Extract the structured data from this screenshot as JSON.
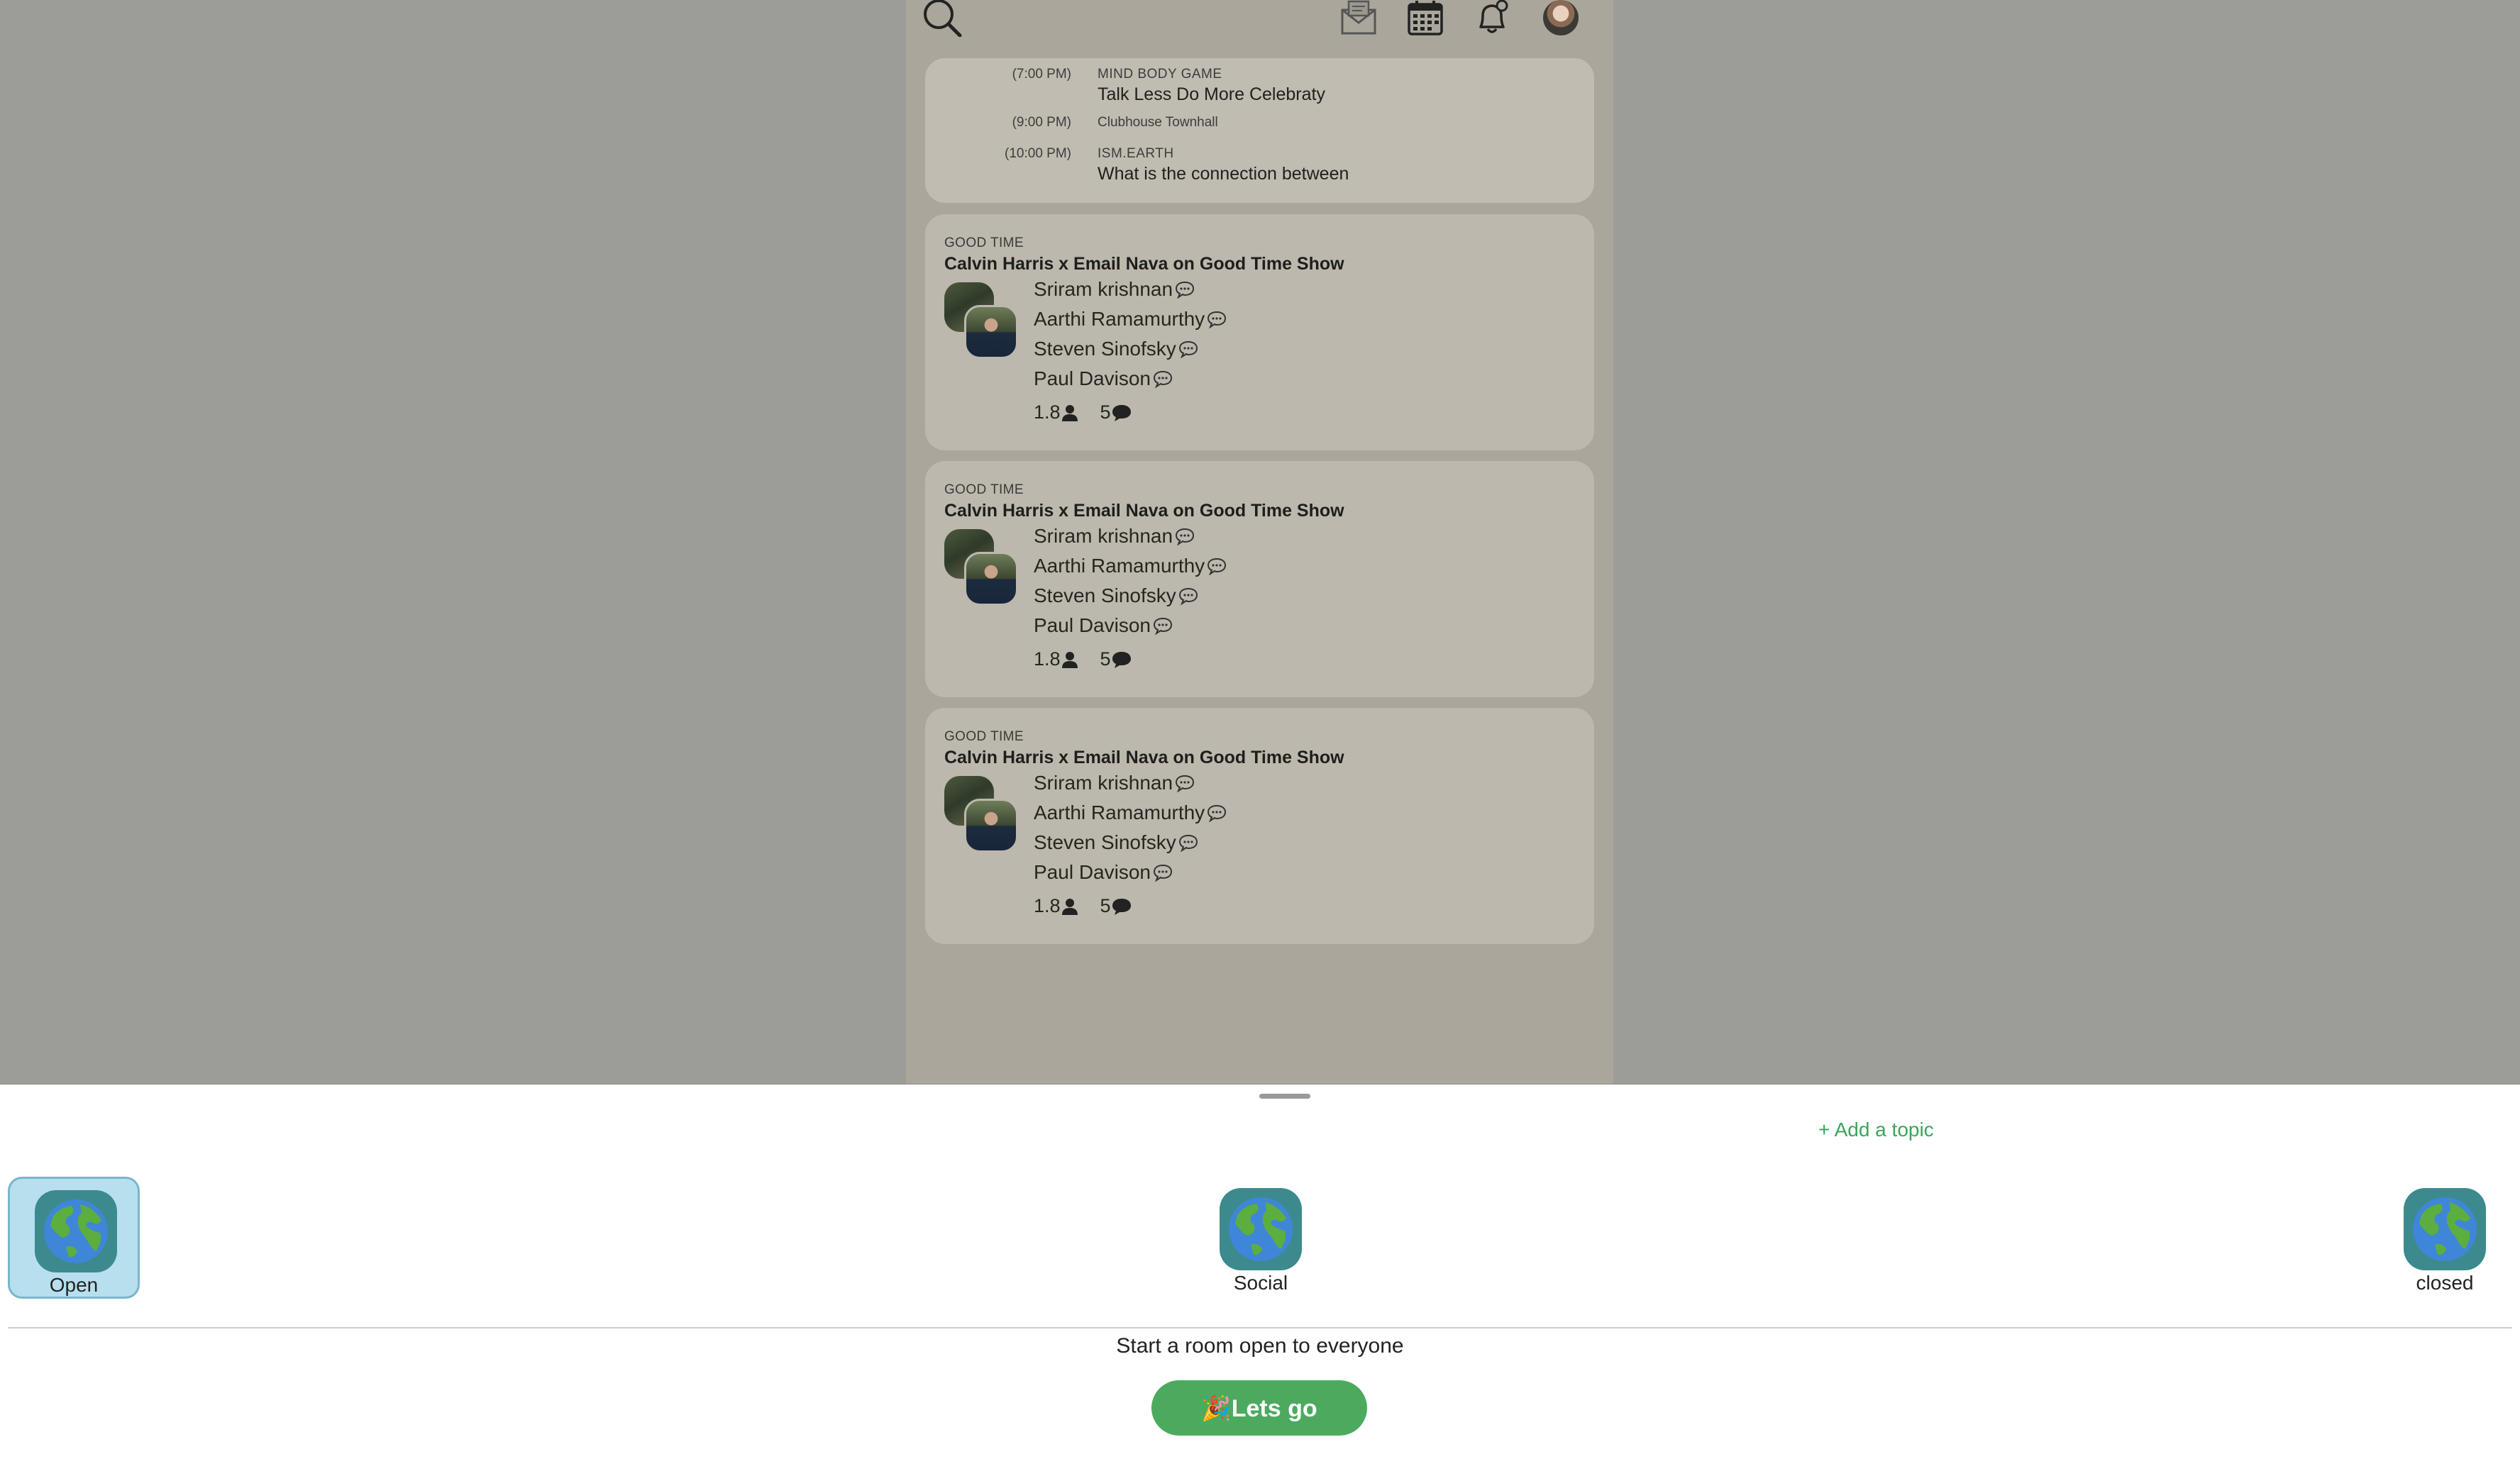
{
  "upcoming": [
    {
      "time": "(7:00 PM)",
      "club": "MIND BODY GAME",
      "title": "Talk Less Do More Celebraty"
    },
    {
      "time": "(9:00 PM)",
      "club": "Clubhouse Townhall",
      "title": ""
    },
    {
      "time": "(10:00 PM)",
      "club": "ISM.EARTH",
      "title": "What is the connection between"
    }
  ],
  "rooms": [
    {
      "club": "GOOD TIME",
      "title": "Calvin Harris x Email Nava on Good Time Show",
      "speakers": [
        "Sriram krishnan",
        "Aarthi Ramamurthy",
        "Steven Sinofsky",
        "Paul Davison"
      ],
      "listeners": "1.8",
      "speaker_count": "5"
    },
    {
      "club": "GOOD TIME",
      "title": "Calvin Harris x Email Nava on Good Time Show",
      "speakers": [
        "Sriram krishnan",
        "Aarthi Ramamurthy",
        "Steven Sinofsky",
        "Paul Davison"
      ],
      "listeners": "1.8",
      "speaker_count": "5"
    },
    {
      "club": "GOOD TIME",
      "title": "Calvin Harris x Email Nava on Good Time Show",
      "speakers": [
        "Sriram krishnan",
        "Aarthi Ramamurthy",
        "Steven Sinofsky",
        "Paul Davison"
      ],
      "listeners": "1.8",
      "speaker_count": "5"
    }
  ],
  "sheet": {
    "add_topic": "+ Add a topic",
    "options": [
      {
        "label": "Open",
        "selected": true
      },
      {
        "label": "Social",
        "selected": false
      },
      {
        "label": "closed",
        "selected": false
      }
    ],
    "description": "Start a room open to everyone",
    "go_emoji": "🎉",
    "go_label": "Lets go"
  },
  "colors": {
    "accent_green": "#4caa5f",
    "link_green": "#3aa55b",
    "selected_bg": "#b8dfee"
  }
}
